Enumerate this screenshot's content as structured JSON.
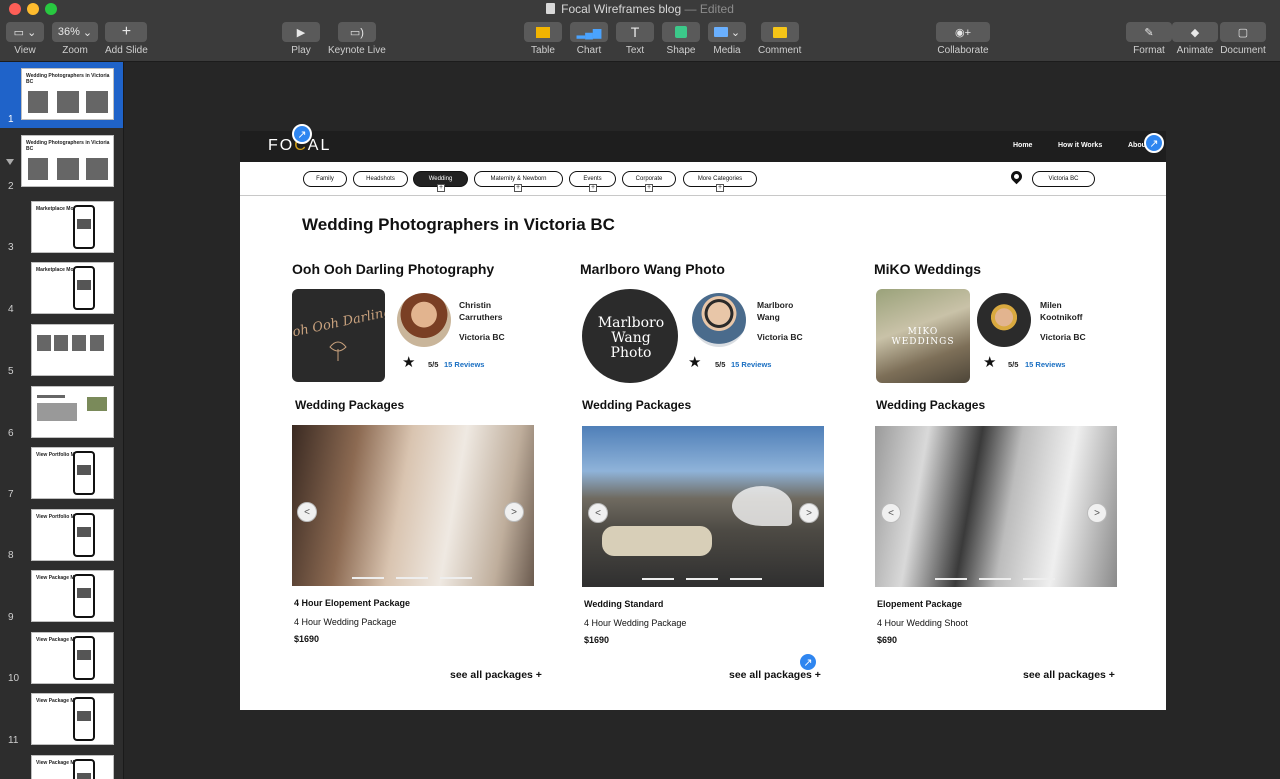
{
  "window": {
    "title": "Focal Wireframes blog",
    "status": "Edited",
    "separator": "—"
  },
  "toolbar": {
    "view": "View",
    "zoom": "Zoom",
    "zoom_value": "36%",
    "add_slide": "Add Slide",
    "play": "Play",
    "keynote_live": "Keynote Live",
    "table": "Table",
    "chart": "Chart",
    "text": "Text",
    "shape": "Shape",
    "media": "Media",
    "comment": "Comment",
    "collaborate": "Collaborate",
    "format": "Format",
    "animate": "Animate",
    "document": "Document"
  },
  "sidebar": {
    "slides": [
      {
        "number": "1",
        "title": "Wedding Photographers in Victoria BC"
      },
      {
        "number": "2",
        "title": "Wedding Photographers in Victoria BC"
      },
      {
        "number": "3",
        "title": "Marketplace Mobile"
      },
      {
        "number": "4",
        "title": "Marketplace Mobile"
      },
      {
        "number": "5",
        "title": ""
      },
      {
        "number": "6",
        "title": ""
      },
      {
        "number": "7",
        "title": "View Portfolio Mobile"
      },
      {
        "number": "8",
        "title": "View Portfolio Mobile"
      },
      {
        "number": "9",
        "title": "View Package Mobile"
      },
      {
        "number": "10",
        "title": "View Package Mobile"
      },
      {
        "number": "11",
        "title": "View Package Mobile"
      },
      {
        "number": "12",
        "title": "View Package Mobile"
      }
    ]
  },
  "slide": {
    "logo": {
      "pre": "FO",
      "accent": "C",
      "post": "AL"
    },
    "nav": {
      "home": "Home",
      "how": "How it Works",
      "about": "About"
    },
    "filters": [
      "Family",
      "Headshots",
      "Wedding",
      "Maternity & Newborn",
      "Events",
      "Corporate",
      "More Categories"
    ],
    "location": "Victoria BC",
    "page_title": "Wedding Photographers in Victoria BC",
    "packages_heading": "Wedding Packages",
    "see_all": "see all packages +",
    "rating": "5/5",
    "reviews": "15 Reviews",
    "cards": [
      {
        "studio": "Ooh Ooh Darling Photography",
        "logo_text": "Ooh Ooh Darling",
        "photographer": "Christin Carruthers",
        "city": "Victoria BC",
        "package_name": "4 Hour Elopement Package",
        "package_desc": "4 Hour Wedding Package",
        "price": "$1690"
      },
      {
        "studio": "Marlboro Wang Photo",
        "logo_text": "Marlboro Wang Photo",
        "photographer": "Marlboro Wang",
        "city": "Victoria BC",
        "package_name": "Wedding Standard",
        "package_desc": "4 Hour Wedding Package",
        "price": "$1690"
      },
      {
        "studio": "MiKO Weddings",
        "logo_text": "MIKO WEDDINGS",
        "photographer": "Milen Kootnikoff",
        "city": "Victoria BC",
        "package_name": "Elopement Package",
        "package_desc": "4 Hour Wedding Shoot",
        "price": "$690"
      }
    ]
  },
  "colors": {
    "selection": "#1f63c9",
    "link": "#1a6fc2",
    "collab": "#2f86f0",
    "logo_accent": "#d4a017"
  }
}
